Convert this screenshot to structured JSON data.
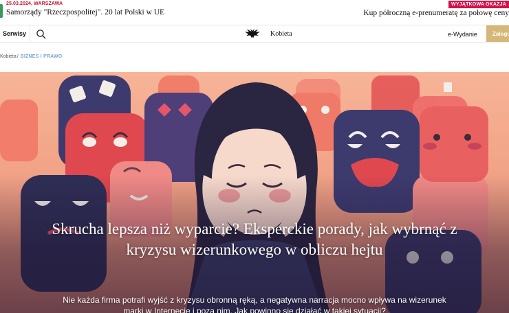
{
  "promo": {
    "date": "25.03.2024, WARSZAWA",
    "headline": "Samorządy \"Rzeczpospolitej\". 20 lat Polski w UE",
    "badge": "WYJĄTKOWA OKAZJA",
    "offer": "Kup półroczną e-prenumeratę za połowę ceny"
  },
  "nav": {
    "serwisy": "Serwisy",
    "brand": "Kobieta",
    "ewydanie": "e-Wydanie",
    "subscribe": "Zaloguj"
  },
  "breadcrumb": {
    "section": "Kobieta",
    "separator": "/",
    "category": "BIZNES I PRAWO"
  },
  "article": {
    "title": "Skrucha lepsza niż wyparcie? Eksperckie porady, jak wybrnąć z kryzysu wizerunkowego w obliczu hejtu",
    "lead": "Nie każda firma potrafi wyjść z kryzysu obronną ręką, a negatywna narracja mocno wpływa na wizerunek marki w Internecie i poza nim. Jak powinno się działać w takiej sytuacji?"
  },
  "icons": {
    "search": "search-icon",
    "logo": "eagle-logo-icon"
  },
  "colors": {
    "date_red": "#c8102e",
    "badge_bg": "#d5124a",
    "breadcrumb_category": "#7aa6c8",
    "subscribe_bg": "#d6b77a",
    "hero_bg": "#f2a07e"
  }
}
